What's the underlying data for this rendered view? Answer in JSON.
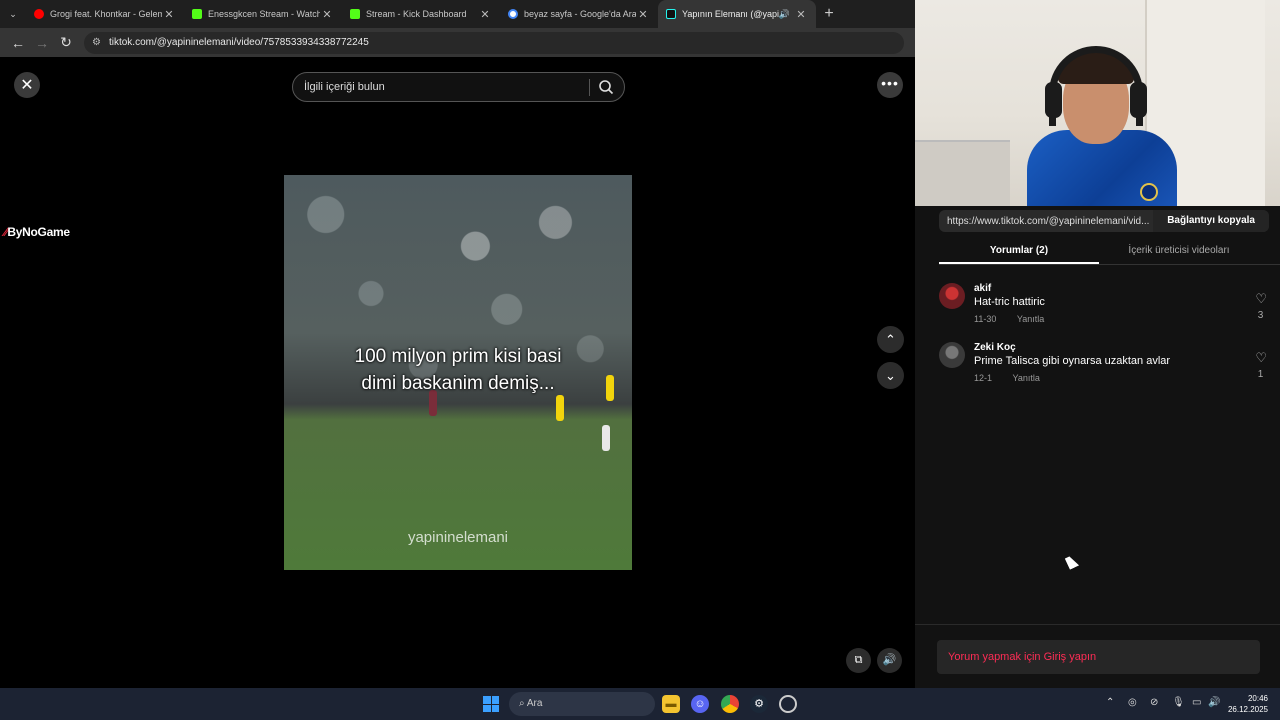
{
  "browser": {
    "tabs": [
      {
        "title": "Grogi feat. Khontkar - Gelemem",
        "favicon_color": "#ff0000",
        "icon": "youtube-icon",
        "active": false
      },
      {
        "title": "Enessgkcen Stream - Watch Live",
        "favicon_color": "#53fc18",
        "icon": "kick-icon",
        "active": false
      },
      {
        "title": "Stream - Kick Dashboard",
        "favicon_color": "#53fc18",
        "icon": "kick-icon",
        "active": false
      },
      {
        "title": "beyaz sayfa - Google'da Ara",
        "favicon_color": "#4285f4",
        "icon": "google-icon",
        "active": false
      },
      {
        "title": "Yapının Elemanı (@yapinine",
        "favicon_color": "#111111",
        "icon": "tiktok-icon",
        "active": true
      }
    ],
    "url": "tiktok.com/@yapininelemani/video/7578533934338772245"
  },
  "viewer": {
    "search_placeholder": "İlgili içeriği bulun",
    "overlay_logo": "ByNoGame",
    "video_caption_line1": "100 milyon prim kisi basi",
    "video_caption_line2": "dimi baskanim demiş...",
    "video_watermark": "yapininelemani"
  },
  "panel": {
    "share_url": "https://www.tiktok.com/@yapininelemani/vid...",
    "copy_link_label": "Bağlantıyı kopyala",
    "tabs": {
      "comments": "Yorumlar (2)",
      "creator_videos": "İçerik üreticisi videoları"
    },
    "comments": [
      {
        "user": "akif",
        "text": "Hat-tric hattiric",
        "date": "11-30",
        "reply": "Yanıtla",
        "likes": "3",
        "avatar_color": "#6b1d22"
      },
      {
        "user": "Zeki Koç",
        "text": "Prime Talisca gibi oynarsa uzaktan avlar",
        "date": "12-1",
        "reply": "Yanıtla",
        "likes": "1",
        "avatar_color": "#3a3a3a"
      }
    ],
    "login_prompt": "Yorum yapmak için Giriş yapın"
  },
  "taskbar": {
    "search_label": "Ara",
    "time": "20:46",
    "date": "26.12.2025"
  },
  "colors": {
    "accent": "#fe2c55",
    "taskbar": "#1c2333"
  }
}
